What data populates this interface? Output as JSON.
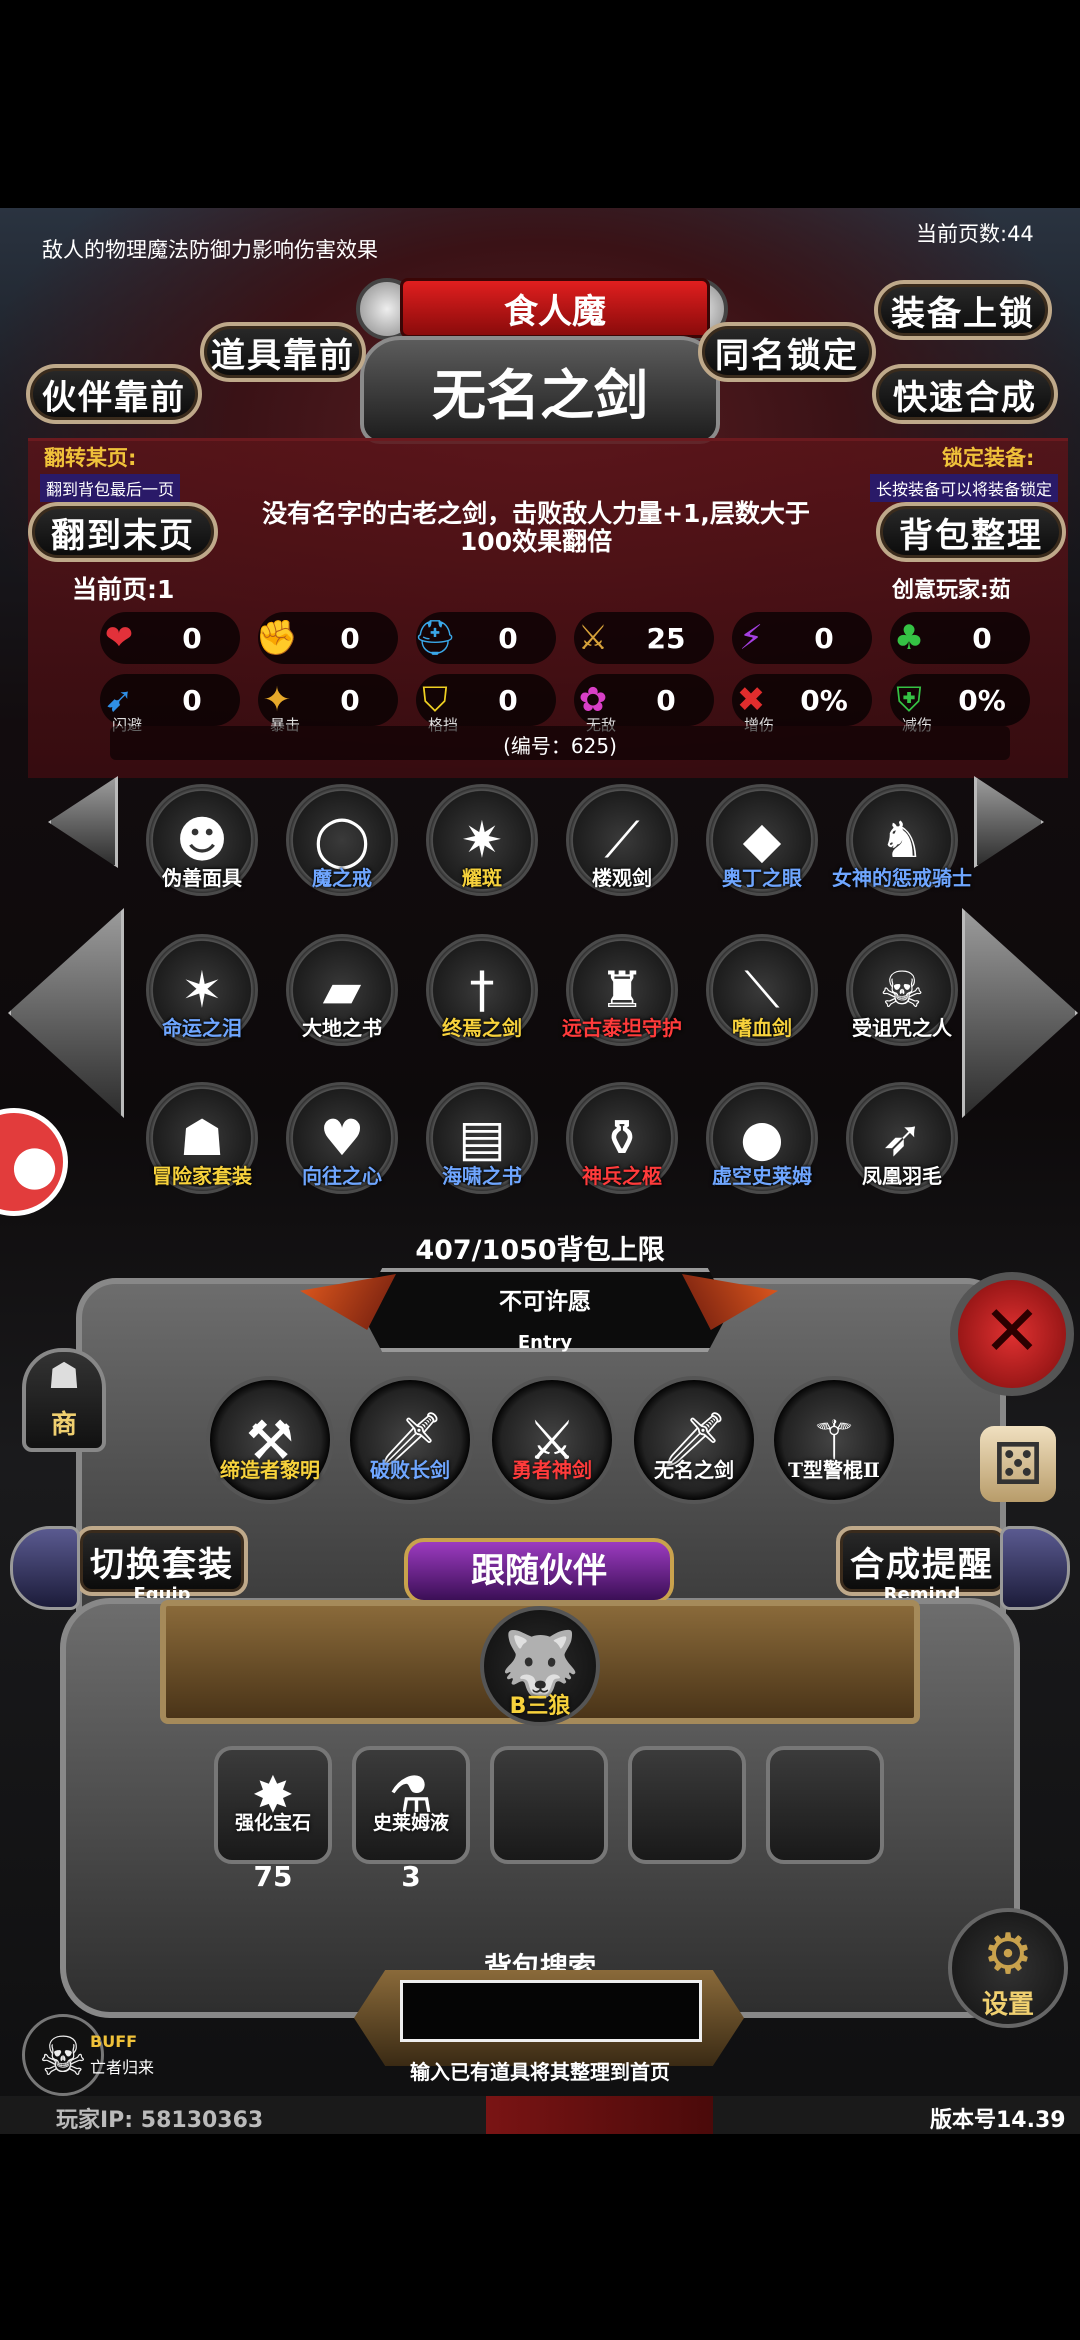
{
  "top_bar": {
    "hint": "敌人的物理魔法防御力影响伤害效果",
    "page_count": "当前页数:44"
  },
  "header": {
    "enemy_name": "食人魔",
    "item_title": "无名之剑"
  },
  "buttons": {
    "item_front": "道具靠前",
    "partner_front": "伙伴靠前",
    "same_name_lock": "同名锁定",
    "equip_lock": "装备上锁",
    "quick_merge": "快速合成",
    "to_last_page": "翻到末页",
    "bag_sort": "背包整理",
    "switch_set": "切换套装",
    "switch_set_en": "Equip",
    "merge_remind": "合成提醒",
    "merge_remind_en": "Remind"
  },
  "page_flip": {
    "label": "翻转某页:",
    "sub": "翻到背包最后一页"
  },
  "lock_equip": {
    "label": "锁定装备:",
    "sub": "长按装备可以将装备锁定"
  },
  "description": "没有名字的古老之剑，击败敌人力量+1,层数大于100效果翻倍",
  "current_page": "当前页:1",
  "creator": "创意玩家:茹",
  "stats_row1": [
    {
      "icon": "heart-icon",
      "glyph": "❤",
      "color": "#e2313a",
      "value": "0"
    },
    {
      "icon": "strength-icon",
      "glyph": "✊",
      "color": "#f4c21f",
      "value": "0"
    },
    {
      "icon": "helmet-icon",
      "glyph": "⛑",
      "color": "#3aa7e8",
      "value": "0"
    },
    {
      "icon": "sword-icon",
      "glyph": "⚔",
      "color": "#d7a23a",
      "value": "25"
    },
    {
      "icon": "lightning-icon",
      "glyph": "⚡",
      "color": "#a53fe0",
      "value": "0"
    },
    {
      "icon": "clover-icon",
      "glyph": "♣",
      "color": "#35c244",
      "value": "0"
    }
  ],
  "stats_row2": [
    {
      "icon": "dodge-icon",
      "glyph": "➹",
      "color": "#2f8fe6",
      "value": "0",
      "label": "闪避"
    },
    {
      "icon": "crit-icon",
      "glyph": "✦",
      "color": "#e7a92b",
      "value": "0",
      "label": "暴击"
    },
    {
      "icon": "block-icon",
      "glyph": "⛉",
      "color": "#efd022",
      "value": "0",
      "label": "格挡"
    },
    {
      "icon": "invincible-icon",
      "glyph": "✿",
      "color": "#d83fc6",
      "value": "0",
      "label": "无敌"
    },
    {
      "icon": "damage-up-icon",
      "glyph": "✖",
      "color": "#e02d2d",
      "value": "0%",
      "label": "增伤"
    },
    {
      "icon": "damage-down-icon",
      "glyph": "⛨",
      "color": "#35c244",
      "value": "0%",
      "label": "减伤"
    }
  ],
  "item_code": "(编号：625)",
  "items": [
    {
      "name": "伪善面具",
      "color": "#ffffff",
      "glyph": "☻"
    },
    {
      "name": "魔之戒",
      "color": "#6fa6ff",
      "glyph": "◯"
    },
    {
      "name": "耀斑",
      "color": "#f7d23c",
      "glyph": "✷"
    },
    {
      "name": "楼观剑",
      "color": "#ffffff",
      "glyph": "⟋"
    },
    {
      "name": "奥丁之眼",
      "color": "#6fa6ff",
      "glyph": "◆"
    },
    {
      "name": "女神的惩戒骑士",
      "color": "#6fa6ff",
      "glyph": "♞"
    },
    {
      "name": "命运之泪",
      "color": "#6fa6ff",
      "glyph": "✶"
    },
    {
      "name": "大地之书",
      "color": "#ffffff",
      "glyph": "▰"
    },
    {
      "name": "终焉之剑",
      "color": "#f7d23c",
      "glyph": "†"
    },
    {
      "name": "远古泰坦守护",
      "color": "#ff3b3b",
      "glyph": "♜"
    },
    {
      "name": "嗜血剑",
      "color": "#f7d23c",
      "glyph": "⟍"
    },
    {
      "name": "受诅咒之人",
      "color": "#ffffff",
      "glyph": "☠"
    },
    {
      "name": "冒险家套装",
      "color": "#f7d23c",
      "glyph": "☗"
    },
    {
      "name": "向往之心",
      "color": "#6fa6ff",
      "glyph": "♥"
    },
    {
      "name": "海啸之书",
      "color": "#6fa6ff",
      "glyph": "▤"
    },
    {
      "name": "神兵之柩",
      "color": "#ff3b3b",
      "glyph": "⚱"
    },
    {
      "name": "虚空史莱姆",
      "color": "#6fa6ff",
      "glyph": "●"
    },
    {
      "name": "凤凰羽毛",
      "color": "#ffffff",
      "glyph": "➶"
    }
  ],
  "bag_limit": "407/1050背包上限",
  "entry": {
    "title": "不可许愿",
    "sub": "Entry"
  },
  "equipped": [
    {
      "name": "缔造者黎明",
      "color": "#f7d23c",
      "glyph": "⚒"
    },
    {
      "name": "破败长剑",
      "color": "#6fa6ff",
      "glyph": "🗡"
    },
    {
      "name": "勇者神剑",
      "color": "#ff3b3b",
      "glyph": "⚔"
    },
    {
      "name": "无名之剑",
      "color": "#ffffff",
      "glyph": "🗡"
    },
    {
      "name": "T型警棍Ⅱ",
      "color": "#ffffff",
      "glyph": "⚚"
    }
  ],
  "follow_partner": {
    "title": "跟随伙伴",
    "partner_name": "B三狼"
  },
  "consumables": [
    {
      "name": "强化宝石",
      "count": "75",
      "glyph": "✸"
    },
    {
      "name": "史莱姆液",
      "count": "3",
      "glyph": "⚗"
    }
  ],
  "side": {
    "shop": "商",
    "settings": "设置"
  },
  "search": {
    "title": "背包搜索",
    "hint": "输入已有道具将其整理到首页",
    "value": ""
  },
  "buff": {
    "label": "BUFF",
    "name": "亡者归来"
  },
  "footer": {
    "player_ip": "玩家IP:  58130363",
    "version": "版本号14.39"
  }
}
